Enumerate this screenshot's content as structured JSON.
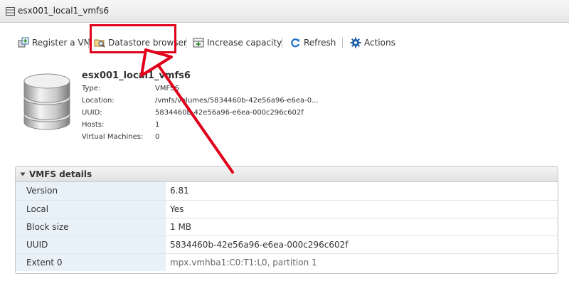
{
  "window": {
    "title": "esx001_local1_vmfs6"
  },
  "toolbar": {
    "register_vm": "Register a VM",
    "datastore_browser": "Datastore browser",
    "increase_capacity": "Increase capacity",
    "refresh": "Refresh",
    "actions": "Actions"
  },
  "summary": {
    "name": "esx001_local1_vmfs6",
    "rows": [
      {
        "label": "Type:",
        "value": "VMFS6"
      },
      {
        "label": "Location:",
        "value": "/vmfs/volumes/5834460b-42e56a96-e6ea-0..."
      },
      {
        "label": "UUID:",
        "value": "5834460b-42e56a96-e6ea-000c296c602f"
      },
      {
        "label": "Hosts:",
        "value": "1"
      },
      {
        "label": "Virtual Machines:",
        "value": "0"
      }
    ]
  },
  "vmfs_details": {
    "title": "VMFS details",
    "rows": [
      {
        "label": "Version",
        "value": "6.81"
      },
      {
        "label": "Local",
        "value": "Yes"
      },
      {
        "label": "Block size",
        "value": "1 MB"
      },
      {
        "label": "UUID",
        "value": "5834460b-42e56a96-e6ea-000c296c602f"
      },
      {
        "label": "Extent 0",
        "value": "mpx.vmhba1:C0:T1:L0, partition 1"
      }
    ]
  },
  "annotation": {
    "color": "#e0001a"
  }
}
